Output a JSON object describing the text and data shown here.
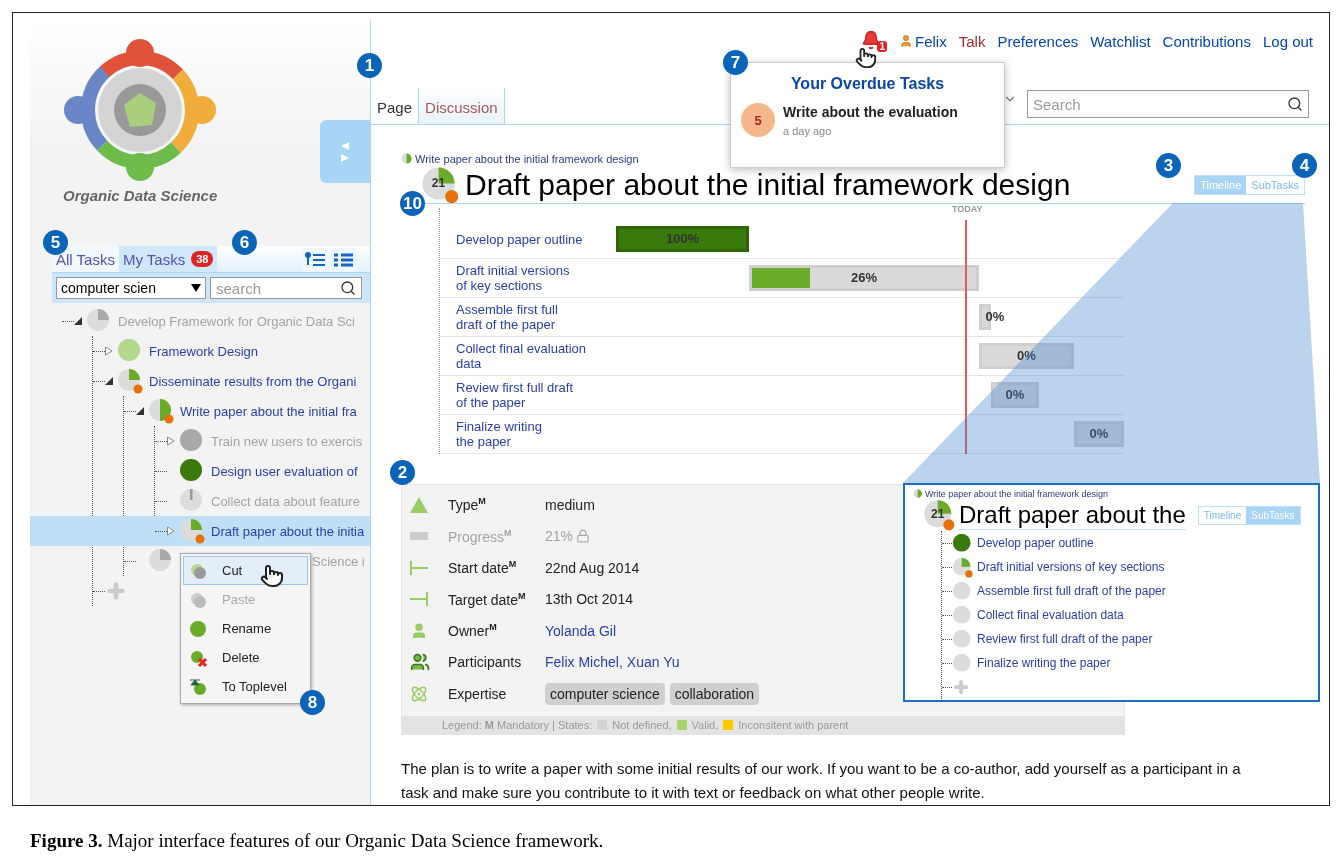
{
  "sidebar": {
    "logo_text": "Organic Data Science",
    "tabs": [
      {
        "label": "All Tasks",
        "selected": true
      },
      {
        "label": "My Tasks",
        "selected": false,
        "badge": "38"
      }
    ],
    "filter": {
      "value": "computer scien"
    },
    "search": {
      "placeholder": "search"
    },
    "tree": [
      {
        "label": "Develop Framework for Organic Data Sci",
        "disabled": true,
        "expanded": true,
        "selected": false,
        "pie": {
          "kind": "partial",
          "color": "#a9a9a9",
          "overdue": false
        },
        "children": [
          {
            "label": "Framework Design",
            "disabled": false,
            "expanded": false,
            "selected": false,
            "pie": {
              "kind": "full",
              "color": "#b3d98c",
              "overdue": false
            }
          },
          {
            "label": "Disseminate results from the Organi",
            "disabled": false,
            "expanded": true,
            "selected": false,
            "pie": {
              "kind": "partial",
              "color": "#6aab2a",
              "overdue": true
            },
            "children": [
              {
                "label": "Write paper about the initial fra",
                "disabled": false,
                "expanded": true,
                "selected": false,
                "pie": {
                  "kind": "half",
                  "color": "#6aab2a",
                  "overdue": true
                },
                "children": [
                  {
                    "label": "Train new users to exercis",
                    "disabled": true,
                    "expanded": false,
                    "selected": false,
                    "pie": {
                      "kind": "full",
                      "color": "#a9a9a9",
                      "overdue": false
                    }
                  },
                  {
                    "label": "Design user evaluation of",
                    "disabled": false,
                    "selected": false,
                    "pie": {
                      "kind": "full",
                      "color": "#3a7a0c",
                      "overdue": false
                    }
                  },
                  {
                    "label": "Collect data about feature",
                    "disabled": true,
                    "selected": false,
                    "pie": {
                      "kind": "sliver",
                      "color": "#999999",
                      "overdue": false
                    }
                  },
                  {
                    "label": "Draft paper about the initia",
                    "disabled": false,
                    "expanded": false,
                    "selected": true,
                    "pie": {
                      "kind": "partial",
                      "color": "#6aab2a",
                      "overdue": true
                    }
                  }
                ]
              },
              {
                "label": "Science i",
                "disabled": true,
                "covered": true,
                "selected": false,
                "pie": {
                  "kind": "partial",
                  "color": "#a9a9a9",
                  "overdue": false
                }
              }
            ]
          },
          {
            "kind": "add"
          }
        ]
      }
    ],
    "context_menu": [
      {
        "label": "Cut",
        "kind": "cut",
        "selected": true,
        "disabled": false
      },
      {
        "label": "Paste",
        "kind": "paste",
        "selected": false,
        "disabled": true
      },
      {
        "label": "Rename",
        "kind": "rename",
        "selected": false,
        "disabled": false
      },
      {
        "label": "Delete",
        "kind": "delete",
        "selected": false,
        "disabled": false
      },
      {
        "label": "To Toplevel",
        "kind": "toplevel",
        "selected": false,
        "disabled": false
      }
    ]
  },
  "header": {
    "notification_count": "1",
    "user": "Felix",
    "links": [
      {
        "label": "Talk",
        "missing": true
      },
      {
        "label": "Preferences",
        "missing": false
      },
      {
        "label": "Watchlist",
        "missing": false
      },
      {
        "label": "Contributions",
        "missing": false
      },
      {
        "label": "Log out",
        "missing": false
      }
    ]
  },
  "page_tabs": [
    {
      "label": "Page",
      "selected": true
    },
    {
      "label": "Discussion",
      "selected": false
    }
  ],
  "search": {
    "placeholder": "Search"
  },
  "overdue_popup": {
    "title": "Your Overdue Tasks",
    "items": [
      {
        "count": "5",
        "title": "Write about the evaluation",
        "time": "a day ago"
      }
    ]
  },
  "task": {
    "breadcrumb_pie": {
      "kind": "half",
      "color": "#6aab2a",
      "overdue": false
    },
    "breadcrumb": "Write paper about the initial framework design",
    "pie": {
      "kind": "partial",
      "color": "#6aab2a",
      "overdue": true
    },
    "progress_label": "21",
    "title": "Draft paper about the initial framework design",
    "views": [
      {
        "label": "Timeline",
        "selected": true
      },
      {
        "label": "SubTasks",
        "selected": false
      }
    ]
  },
  "timeline": {
    "today_label": "TODAY",
    "rows": [
      {
        "label": "Develop paper outline",
        "percent": "100%",
        "level": 1
      },
      {
        "label": "Draft initial versions\nof key sections",
        "percent": "26%",
        "level": 0.26
      },
      {
        "label": "Assemble first full\ndraft of the paper",
        "percent": "0%"
      },
      {
        "label": "Collect final evaluation\ndata",
        "percent": "0%"
      },
      {
        "label": "Review first full draft\nof the paper",
        "percent": "0%"
      },
      {
        "label": "Finalize writing\nthe paper",
        "percent": "0%"
      }
    ]
  },
  "details": {
    "rows": [
      {
        "kind": "type",
        "label": "Type$^{M}$",
        "values": [
          "medium"
        ],
        "disabled": false
      },
      {
        "kind": "progress",
        "label": "Progress$^{M}$",
        "values": [
          "21%"
        ],
        "disabled": true
      },
      {
        "kind": "start",
        "label": "Start date$^{M}$",
        "values": [
          "22nd Aug 2014"
        ],
        "disabled": false
      },
      {
        "kind": "target",
        "label": "Target date$^{M}$",
        "values": [
          "13th Oct 2014"
        ],
        "disabled": false
      },
      {
        "kind": "owner",
        "label": "Owner$^{M}$",
        "values": [
          "Yolanda Gil"
        ],
        "disabled": false
      },
      {
        "kind": "participants",
        "label": "Participants",
        "values": [
          "Felix Michel,",
          "Xuan Yu"
        ],
        "disabled": false
      },
      {
        "kind": "expertise",
        "label": "Expertise",
        "values": [
          "computer science",
          "collaboration"
        ],
        "disabled": false
      }
    ],
    "legend": {
      "text": "Legend: **M** Mandatory | States:",
      "states": [
        {
          "label": "Not defined,",
          "color": "#d3d3d3"
        },
        {
          "label": "Valid,",
          "color": "#a8d46f"
        },
        {
          "label": "Inconsitent with parent",
          "color": "#ffcc00"
        }
      ]
    }
  },
  "description": "The plan is to write a paper with some initial results of our work. If you want to be a co-author, add yourself as a participant in a task and make sure you contribute to it with text or feedback on what other people write.",
  "inset": {
    "breadcrumb_pie": {
      "kind": "half",
      "color": "#6aab2a",
      "overdue": false
    },
    "breadcrumb": "Write paper about the initial framework design",
    "pie": {
      "kind": "partial",
      "color": "#6aab2a",
      "overdue": true
    },
    "progress_label": "21",
    "title": "Draft paper about the",
    "views": [
      {
        "label": "Timeline",
        "selected": false
      },
      {
        "label": "SubTasks",
        "selected": true
      }
    ],
    "subtasks": [
      {
        "label": "Develop paper outline",
        "pie": {
          "kind": "full",
          "color": "#3a7a0c",
          "overdue": false
        }
      },
      {
        "label": "Draft initial versions of key sections",
        "pie": {
          "kind": "partial",
          "color": "#6aab2a",
          "overdue": true
        }
      },
      {
        "label": "Assemble first full draft of the paper",
        "pie": {
          "kind": "empty",
          "overdue": false
        }
      },
      {
        "label": "Collect final evaluation data",
        "pie": {
          "kind": "empty",
          "overdue": false
        }
      },
      {
        "label": "Review first full draft of the paper",
        "pie": {
          "kind": "empty",
          "overdue": false
        }
      },
      {
        "label": "Finalize writing the paper",
        "pie": {
          "kind": "empty",
          "overdue": false
        }
      }
    ]
  },
  "callouts": [
    "1",
    "2",
    "3",
    "4",
    "5",
    "6",
    "7",
    "8",
    "10"
  ],
  "caption": "**Figure 3.** Major interface features of our Organic Data Science framework."
}
